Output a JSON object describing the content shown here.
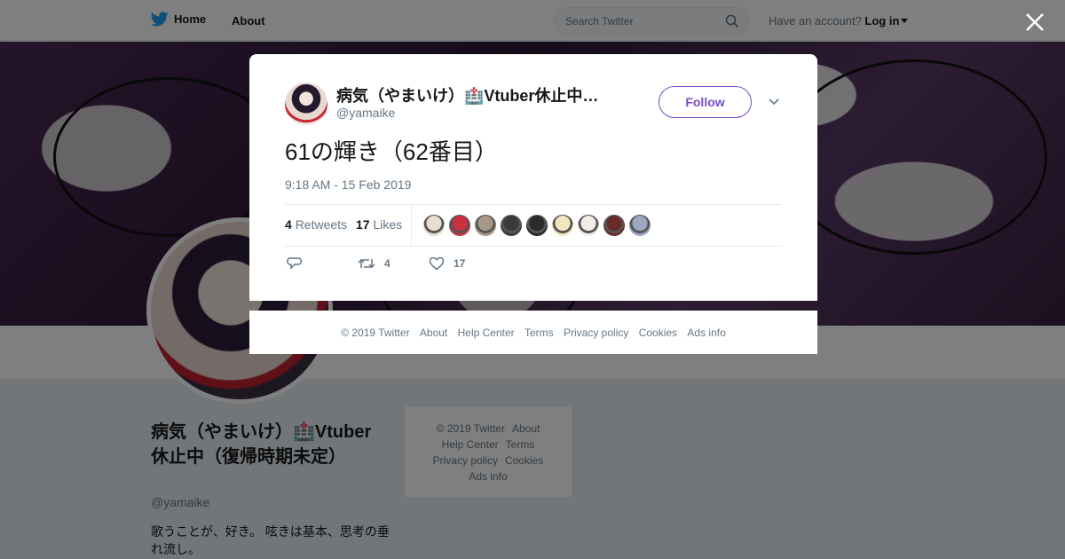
{
  "topbar": {
    "home_label": "Home",
    "about_label": "About",
    "search_placeholder": "Search Twitter",
    "account_prompt": "Have an account?",
    "login_label": "Log in"
  },
  "profile": {
    "name": "病気（やまいけ）🏥Vtuber休止中（復帰時期未定）",
    "handle": "@yamaike",
    "bio": "歌うことが、好き。 呟きは基本、思考の垂れ流し。"
  },
  "side_footer": {
    "copyright": "© 2019 Twitter",
    "about": "About",
    "help": "Help Center",
    "terms": "Terms",
    "privacy": "Privacy policy",
    "cookies": "Cookies",
    "ads": "Ads info"
  },
  "tweet": {
    "author_name": "病気（やまいけ）🏥Vtuber休止中（復帰時期未定）",
    "author_handle": "@yamaike",
    "follow_label": "Follow",
    "text": "61の輝き（62番目）",
    "timestamp": "9:18 AM - 15 Feb 2019",
    "retweets_count": "4",
    "retweets_label": "Retweets",
    "likes_count": "17",
    "likes_label": "Likes",
    "action_retweet_count": "4",
    "action_like_count": "17",
    "likers": [
      "#e8ddd0",
      "#c93040",
      "#a89888",
      "#3a3a3a",
      "#2a2a2a",
      "#f0e6c0",
      "#f2ece6",
      "#6a2a2a",
      "#9aa8c0"
    ]
  },
  "modal_footer": {
    "copyright": "© 2019 Twitter",
    "about": "About",
    "help": "Help Center",
    "terms": "Terms",
    "privacy": "Privacy policy",
    "cookies": "Cookies",
    "ads": "Ads info"
  },
  "colors": {
    "accent": "#794bc4",
    "twitter_blue": "#1da1f2",
    "muted_text": "#657786"
  }
}
